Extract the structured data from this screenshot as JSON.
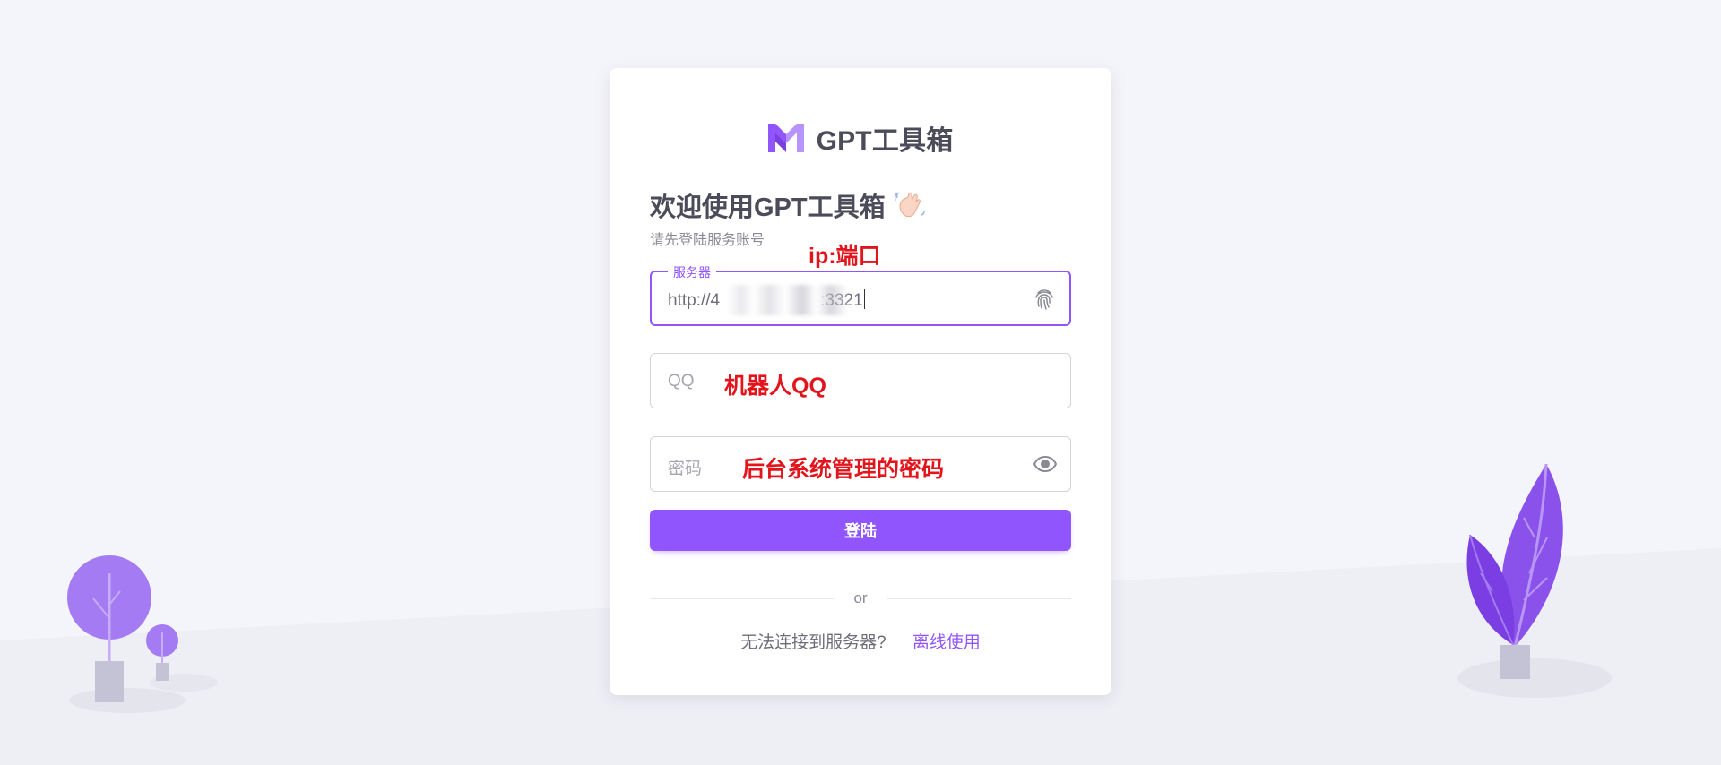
{
  "brand": {
    "name": "GPT工具箱",
    "logo_icon": "m-logo-icon",
    "accent_color": "#9155fd"
  },
  "welcome": {
    "title": "欢迎使用GPT工具箱",
    "emoji_icon": "waving-hand-icon",
    "subtitle": "请先登陆服务账号"
  },
  "form": {
    "server": {
      "label": "服务器",
      "value_prefix": "http://4",
      "value_suffix": ":3321",
      "icon": "fingerprint-icon"
    },
    "qq": {
      "placeholder": "QQ"
    },
    "password": {
      "placeholder": "密码",
      "icon": "eye-icon"
    },
    "submit_label": "登陆"
  },
  "divider_text": "or",
  "footer": {
    "question": "无法连接到服务器?",
    "link_label": "离线使用"
  },
  "annotations": {
    "server": "ip:端口",
    "qq": "机器人QQ",
    "password": "后台系统管理的密码",
    "color": "#e3151c"
  }
}
